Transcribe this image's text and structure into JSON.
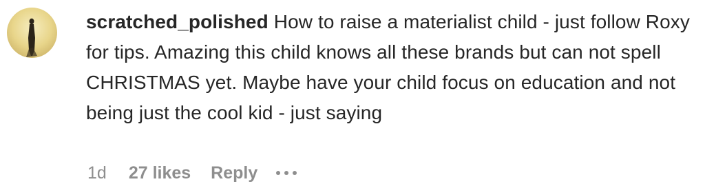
{
  "comment": {
    "username": "scratched_polished",
    "text": "How to raise a materialist child - just follow Roxy for tips. Amazing this child knows all these brands but can not spell CHRISTMAS yet. Maybe have your child focus on education and not being just the cool kid - just saying",
    "time": "1d",
    "likes": "27 likes",
    "reply_label": "Reply",
    "more_icon": "ellipsis-icon"
  },
  "colors": {
    "text": "#262626",
    "meta": "#8e8e8e",
    "avatar_bg": "#e8d58a",
    "avatar_figure": "#2b2418"
  }
}
